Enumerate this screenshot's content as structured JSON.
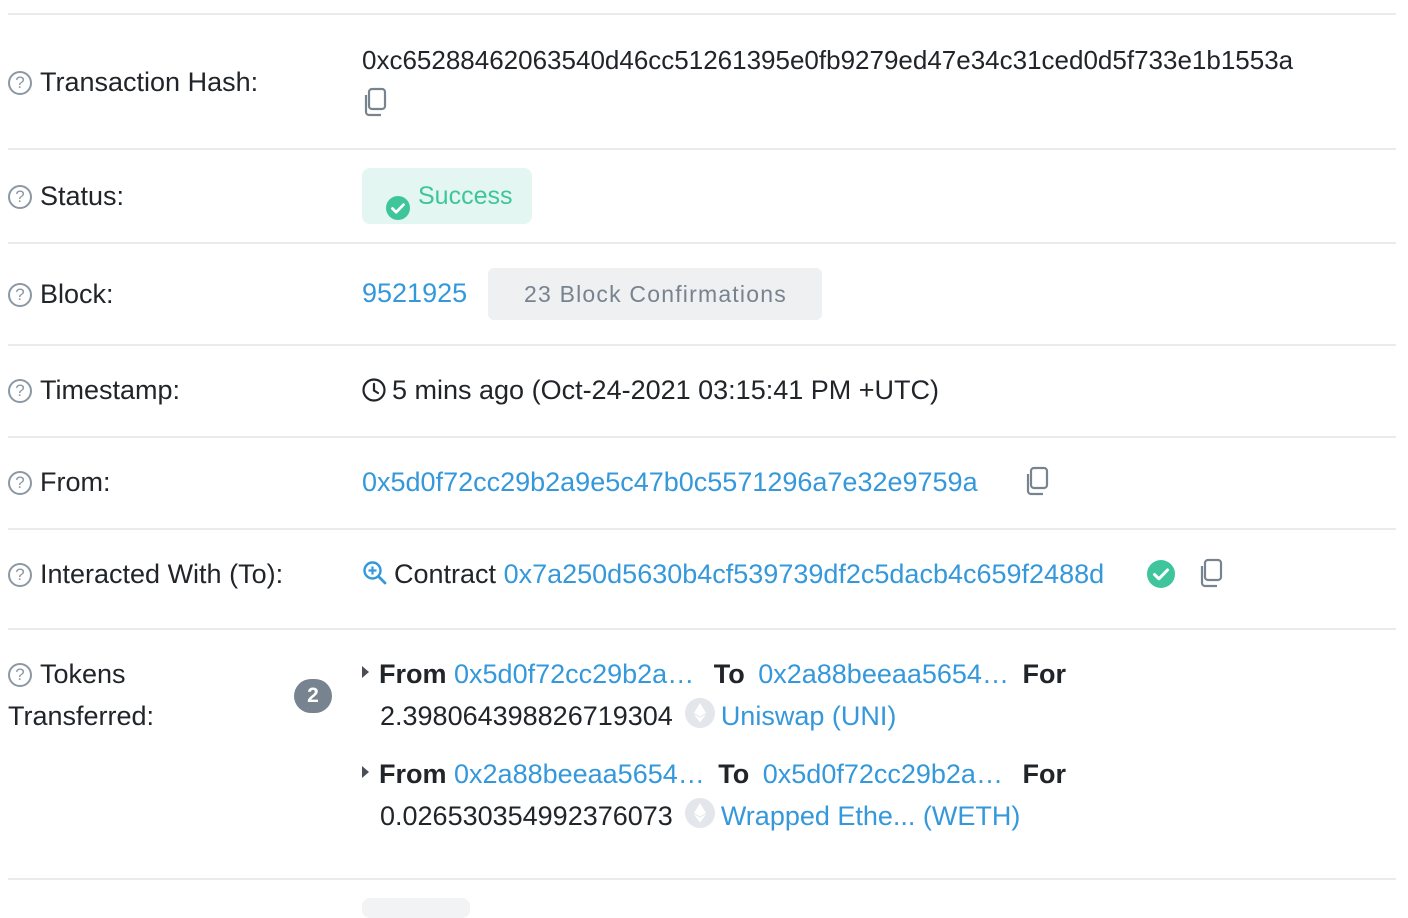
{
  "rows": {
    "hash": {
      "label": "Transaction Hash:",
      "value": "0xc65288462063540d46cc51261395e0fb9279ed47e34c31ced0d5f733e1b1553a"
    },
    "status": {
      "label": "Status:",
      "value": "Success"
    },
    "block": {
      "label": "Block:",
      "number": "9521925",
      "confirmations": "23 Block Confirmations"
    },
    "timestamp": {
      "label": "Timestamp:",
      "value": "5 mins ago (Oct-24-2021 03:15:41 PM +UTC)"
    },
    "from": {
      "label": "From:",
      "value": "0x5d0f72cc29b2a9e5c47b0c5571296a7e32e9759a"
    },
    "to": {
      "label": "Interacted With (To):",
      "prefix": "Contract",
      "value": "0x7a250d5630b4cf539739df2c5dacb4c659f2488d"
    },
    "tokens": {
      "label_line1": "Tokens",
      "label_line2": "Transferred:",
      "count": "2",
      "transfers": [
        {
          "from_word": "From",
          "from": "0x5d0f72cc29b2a…",
          "to_word": "To",
          "to": "0x2a88beeaa5654…",
          "for_word": "For",
          "amount": "2.398064398826719304",
          "token": "Uniswap (UNI)"
        },
        {
          "from_word": "From",
          "from": "0x2a88beeaa5654…",
          "to_word": "To",
          "to": "0x5d0f72cc29b2a…",
          "for_word": "For",
          "amount": "0.026530354992376073",
          "token": "Wrapped Ethe... (WETH)"
        }
      ]
    }
  },
  "icons": {
    "help": "?"
  },
  "colors": {
    "link": "#3498db",
    "success": "#3ec59b",
    "success_bg": "#e3f6f1",
    "muted": "#77838f"
  }
}
